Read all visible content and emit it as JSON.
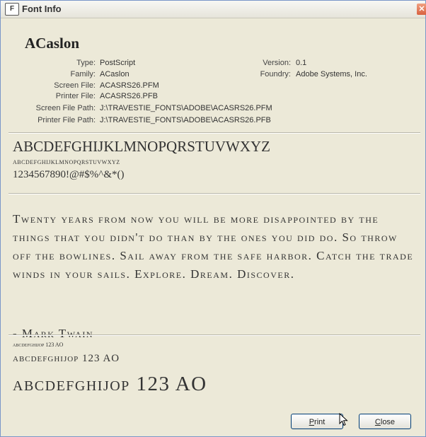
{
  "window": {
    "title": "Font Info",
    "app_icon": "font-app-icon",
    "close_icon": "close-icon"
  },
  "font": {
    "name": "ACaslon",
    "details": {
      "type_label": "Type:",
      "type_value": "PostScript",
      "version_label": "Version:",
      "version_value": "0.1",
      "family_label": "Family:",
      "family_value": "ACaslon",
      "foundry_label": "Foundry:",
      "foundry_value": "Adobe Systems, Inc.",
      "screen_file_label": "Screen File:",
      "screen_file_value": "ACASRS26.PFM",
      "printer_file_label": "Printer File:",
      "printer_file_value": "ACASRS26.PFB",
      "screen_path_label": "Screen File Path:",
      "screen_path_value": "J:\\TRAVESTIE_FONTS\\ADOBE\\ACASRS26.PFM",
      "printer_path_label": "Printer File Path:",
      "printer_path_value": "J:\\TRAVESTIE_FONTS\\ADOBE\\ACASRS26.PFB"
    }
  },
  "charset": {
    "uppercase": "ABCDEFGHIJKLMNOPQRSTUVWXYZ",
    "smallcaps": "abcdefghijklmnopqrstuvwxyz",
    "numbers": "1234567890!@#$%^&*()"
  },
  "sample": {
    "quote": "Twenty years from now you will be more disappointed by the things that you didn't do than by the ones you did do. So throw off the bowlines. Sail away from the safe harbor. Catch the trade winds in your sails. Explore. Dream. Discover.",
    "author": "- Mark Twain"
  },
  "size_samples": [
    {
      "text": "abcdefghijop 123 AO"
    },
    {
      "text": "abcdefghijop 123 AO"
    },
    {
      "text": "abcdefghijop 123 AO"
    }
  ],
  "buttons": {
    "print_hotkey": "P",
    "print_rest": "rint",
    "close_hotkey": "C",
    "close_rest": "lose"
  }
}
